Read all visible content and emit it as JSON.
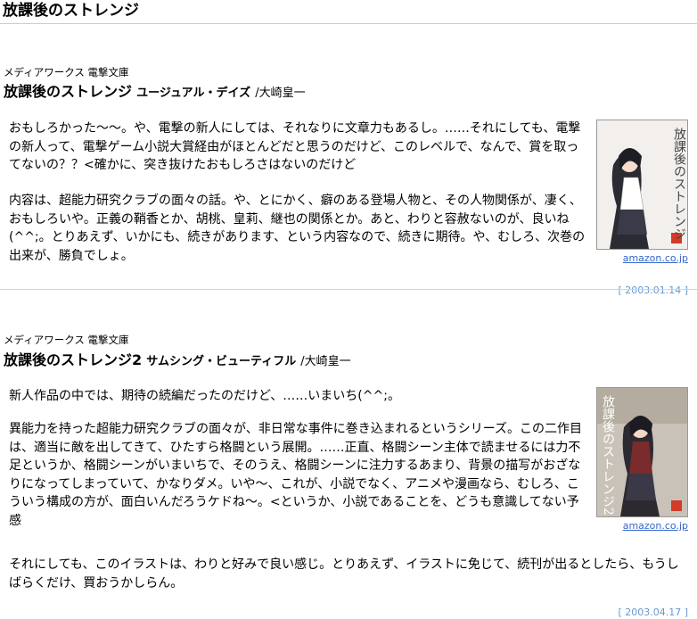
{
  "page": {
    "title": "放課後のストレンジ"
  },
  "reviews": [
    {
      "publisher": "メディアワークス 電撃文庫",
      "title": "放課後のストレンジ",
      "subtitle": "ユージュアル・デイズ",
      "author": "/大崎皇一",
      "paragraphs": [
        "おもしろかった〜〜。や、電撃の新人にしては、それなりに文章力もあるし。……それにしても、電撃の新人って、電撃ゲーム小説大賞経由がほとんどだと思うのだけど、このレベルで、なんで、賞を取ってないの？？<確かに、突き抜けたおもしろさはないのだけど",
        "内容は、超能力研究クラブの面々の話。や、とにかく、癖のある登場人物と、その人物関係が、凄く、おもしろいや。正義の鞘香とか、胡桃、皇莉、継也の関係とか。あと、わりと容赦ないのが、良いね(^^;。とりあえず、いかにも、続きがあります、という内容なので、続きに期待。や、むしろ、次巻の出来が、勝負でしょ。"
      ],
      "cover_text": "放課後のストレンジ",
      "amazon": "amazon.co.jp",
      "date": "[ 2003.01.14 ]"
    },
    {
      "publisher": "メディアワークス 電撃文庫",
      "title": "放課後のストレンジ2",
      "subtitle": "サムシング・ビューティフル",
      "author": "/大崎皇一",
      "paragraphs": [
        "新人作品の中では、期待の続編だったのだけど、……いまいち(^^;。",
        "異能力を持った超能力研究クラブの面々が、非日常な事件に巻き込まれるというシリーズ。この二作目は、適当に敵を出してきて、ひたすら格闘という展開。……正直、格闘シーン主体で読ませるには力不足というか、格闘シーンがいまいちで、そのうえ、格闘シーンに注力するあまり、背景の描写がおざなりになってしまっていて、かなりダメ。いや〜、これが、小説でなく、アニメや漫画なら、むしろ、こういう構成の方が、面白いんだろうケドね〜。<というか、小説であることを、どうも意識してない予感",
        "それにしても、このイラストは、わりと好みで良い感じ。とりあえず、イラストに免じて、続刊が出るとしたら、もうしばらくだけ、買おうかしらん。"
      ],
      "cover_text": "放課後のストレンジ2",
      "amazon": "amazon.co.jp",
      "date": "[ 2003.04.17 ]"
    }
  ]
}
